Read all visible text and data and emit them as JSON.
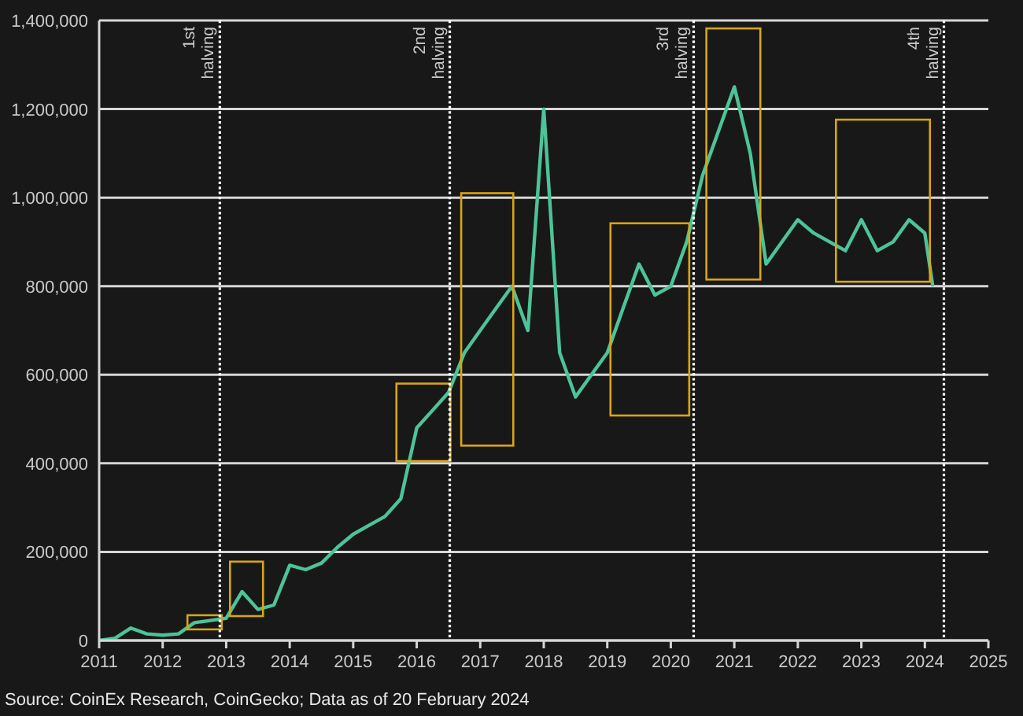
{
  "chart": {
    "chart_data": {
      "type": "line",
      "x": [
        2011,
        2011.25,
        2011.5,
        2011.75,
        2012,
        2012.25,
        2012.5,
        2012.75,
        2013,
        2013.25,
        2013.5,
        2013.75,
        2014,
        2014.25,
        2014.5,
        2014.75,
        2015,
        2015.25,
        2015.5,
        2015.75,
        2016,
        2016.25,
        2016.5,
        2016.75,
        2017,
        2017.25,
        2017.5,
        2017.75,
        2018,
        2018.25,
        2018.5,
        2018.75,
        2019,
        2019.25,
        2019.5,
        2019.75,
        2020,
        2020.25,
        2020.5,
        2020.75,
        2021,
        2021.25,
        2021.5,
        2021.75,
        2022,
        2022.25,
        2022.5,
        2022.75,
        2023,
        2023.25,
        2023.5,
        2023.75,
        2024,
        2024.125
      ],
      "series": [
        {
          "color": "#4cc497",
          "values": [
            0,
            5000,
            28000,
            15000,
            12000,
            15000,
            40000,
            45000,
            50000,
            110000,
            70000,
            80000,
            170000,
            160000,
            175000,
            210000,
            240000,
            260000,
            280000,
            320000,
            480000,
            520000,
            560000,
            650000,
            700000,
            750000,
            800000,
            700000,
            1200000,
            650000,
            550000,
            600000,
            650000,
            750000,
            850000,
            780000,
            800000,
            900000,
            1050000,
            1150000,
            1250000,
            1100000,
            850000,
            900000,
            950000,
            920000,
            900000,
            880000,
            950000,
            880000,
            900000,
            950000,
            920000,
            800000
          ]
        }
      ],
      "xlim": [
        2011,
        2025
      ],
      "ylim": [
        0,
        1400000
      ],
      "xticks": [
        2011,
        2012,
        2013,
        2014,
        2015,
        2016,
        2017,
        2018,
        2019,
        2020,
        2021,
        2022,
        2023,
        2024,
        2025
      ],
      "yticks": [
        {
          "value": 0,
          "label": "0"
        },
        {
          "value": 200000,
          "label": "200,000"
        },
        {
          "value": 400000,
          "label": "400,000"
        },
        {
          "value": 600000,
          "label": "600,000"
        },
        {
          "value": 800000,
          "label": "800,000"
        },
        {
          "value": 1000000,
          "label": "1,000,000"
        },
        {
          "value": 1200000,
          "label": "1,200,000"
        },
        {
          "value": 1400000,
          "label": "1,400,000"
        }
      ],
      "grid": true,
      "ref_lines": [
        {
          "axis": "x",
          "value": 2012.9,
          "label": "1st halving"
        },
        {
          "axis": "x",
          "value": 2016.52,
          "label": "2nd halving"
        },
        {
          "axis": "x",
          "value": 2020.36,
          "label": "3rd halving"
        },
        {
          "axis": "x",
          "value": 2024.3,
          "label": "4th halving"
        }
      ]
    }
  },
  "source": "Source: CoinEx Research, CoinGecko; Data as of 20 February 2024"
}
